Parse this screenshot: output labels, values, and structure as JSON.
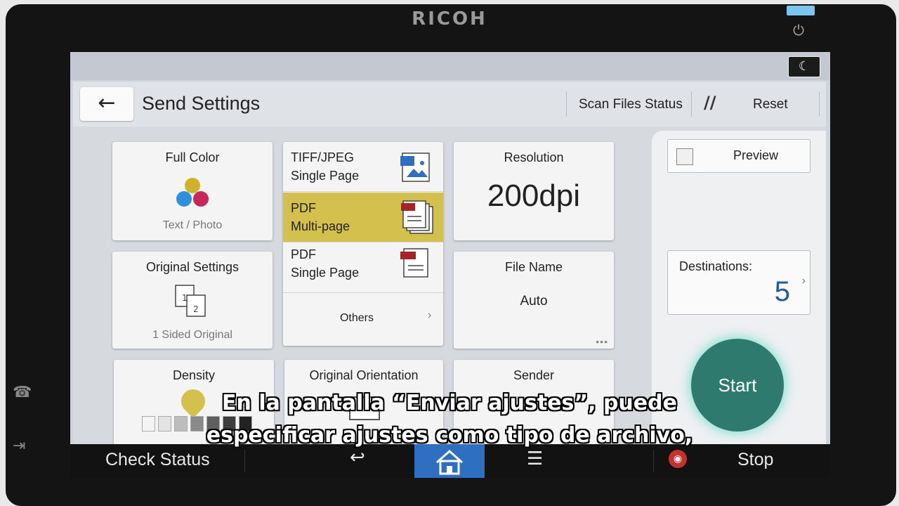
{
  "device": {
    "brand": "RICOH"
  },
  "header": {
    "title": "Send Settings",
    "scan_files_status": "Scan Files Status",
    "reset": "Reset"
  },
  "tiles": {
    "color": {
      "label": "Full Color",
      "sub": "Text / Photo"
    },
    "original_settings": {
      "label": "Original Settings",
      "sub": "1 Sided Original"
    },
    "density": {
      "label": "Density"
    },
    "resolution": {
      "label": "Resolution",
      "value": "200dpi"
    },
    "file_name": {
      "label": "File Name",
      "value": "Auto"
    },
    "original_orientation": {
      "label": "Original Orientation"
    },
    "sender": {
      "label": "Sender"
    }
  },
  "file_types": [
    {
      "line1": "TIFF/JPEG",
      "line2": "Single Page",
      "selected": false
    },
    {
      "line1": "PDF",
      "line2": "Multi-page",
      "selected": true
    },
    {
      "line1": "PDF",
      "line2": "Single Page",
      "selected": false
    }
  ],
  "file_types_others": "Others",
  "right_panel": {
    "preview": "Preview",
    "destinations_label": "Destinations:",
    "destinations_count": "5",
    "start": "Start"
  },
  "bottom_bar": {
    "check_status": "Check Status",
    "stop": "Stop"
  },
  "subtitles": {
    "line1": "En la pantalla “Enviar ajustes”, puede",
    "line2": "especificar ajustes como tipo de archivo,"
  },
  "colors": {
    "selected_file_type": "#d4c14d",
    "start_button": "#2f7a6e",
    "home_button": "#2f6fc1",
    "destinations_count": "#1f5aa6"
  }
}
